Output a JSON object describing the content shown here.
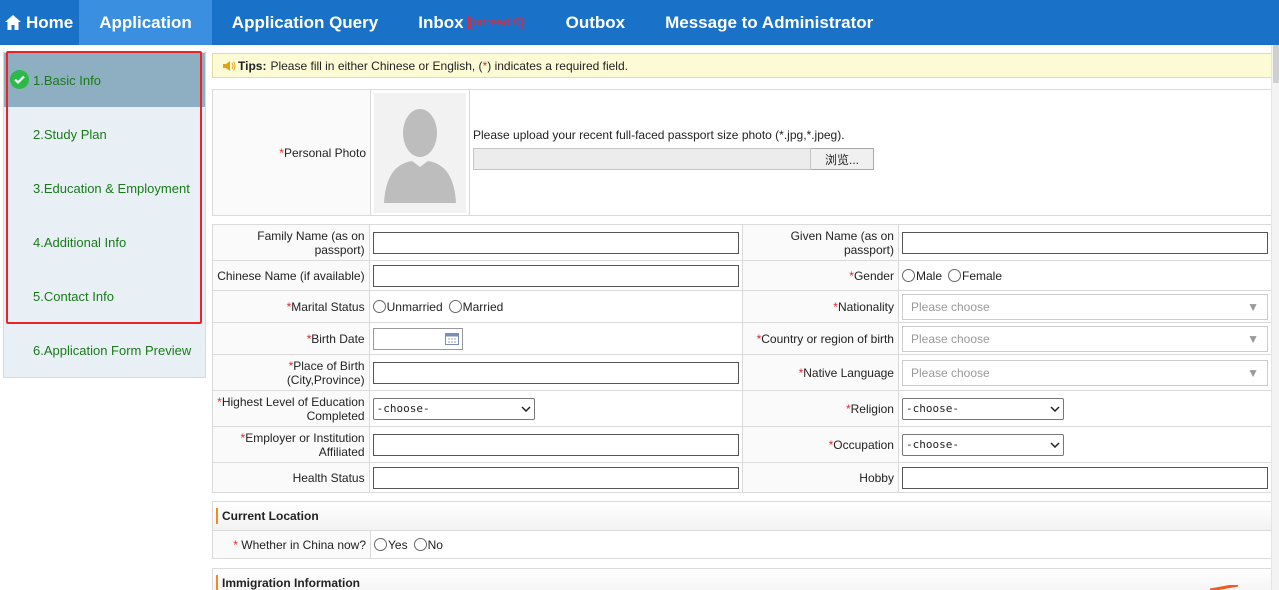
{
  "nav": {
    "home": "Home",
    "application": "Application",
    "query": "Application Query",
    "inbox": "Inbox",
    "unread": "[unread:0]",
    "outbox": "Outbox",
    "message": "Message to Administrator"
  },
  "sidebar": {
    "items": [
      {
        "label": "1.Basic Info"
      },
      {
        "label": "2.Study Plan"
      },
      {
        "label": "3.Education & Employment"
      },
      {
        "label": "4.Additional Info"
      },
      {
        "label": "5.Contact Info"
      },
      {
        "label": "6.Application Form Preview"
      }
    ]
  },
  "tips": {
    "label": "Tips:",
    "text_before": "Please fill in either Chinese or English, (",
    "star": "*",
    "text_after": ") indicates a required field."
  },
  "photo": {
    "label": "Personal Photo",
    "instruction": "Please upload your recent full-faced passport size photo (*.jpg,*.jpeg).",
    "browse": "浏览..."
  },
  "form": {
    "star": "*",
    "family_name": "Family Name (as on passport)",
    "given_name": "Given Name (as on passport)",
    "chinese_name": "Chinese Name (if available)",
    "gender": "Gender",
    "male": "Male",
    "female": "Female",
    "marital": "Marital Status",
    "unmarried": "Unmarried",
    "married": "Married",
    "nationality": "Nationality",
    "please_choose": "Please choose",
    "birth_date": "Birth Date",
    "birth_country": "Country or region of birth",
    "birth_place": "Place of Birth (City,Province)",
    "native_language": "Native Language",
    "education": "Highest Level of Education Completed",
    "choose": "-choose-",
    "religion": "Religion",
    "employer": "Employer or Institution Affiliated",
    "occupation": "Occupation",
    "health": "Health Status",
    "hobby": "Hobby"
  },
  "location": {
    "title": "Current Location",
    "question": "Whether in China now?",
    "yes": "Yes",
    "no": "No"
  },
  "immigration": {
    "title": "Immigration Information"
  }
}
